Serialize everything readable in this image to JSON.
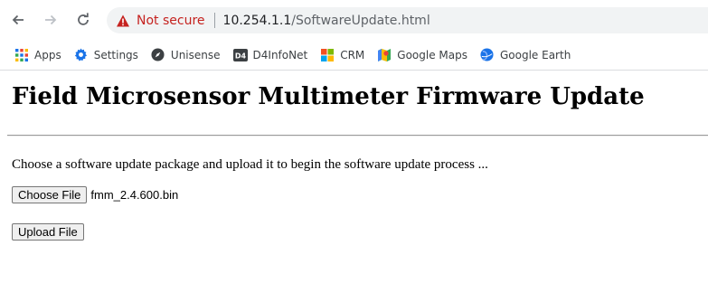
{
  "browser": {
    "security_label": "Not secure",
    "url_host": "10.254.1.1",
    "url_path": "/SoftwareUpdate.html",
    "colors": {
      "warning": "#c5221f",
      "omnibox_bg": "#f1f3f4"
    }
  },
  "bookmarks": [
    {
      "label": "Apps",
      "icon": "apps-grid-icon"
    },
    {
      "label": "Settings",
      "icon": "gear-icon"
    },
    {
      "label": "Unisense",
      "icon": "compass-icon"
    },
    {
      "label": "D4InfoNet",
      "icon": "d4-logo-icon"
    },
    {
      "label": "CRM",
      "icon": "windows-logo-icon"
    },
    {
      "label": "Google Maps",
      "icon": "maps-icon"
    },
    {
      "label": "Google Earth",
      "icon": "earth-icon"
    }
  ],
  "page": {
    "title": "Field Microsensor Multimeter Firmware Update",
    "instructions": "Choose a software update package and upload it to begin the software update process ...",
    "choose_file_label": "Choose File",
    "selected_file": "fmm_2.4.600.bin",
    "upload_label": "Upload File"
  }
}
